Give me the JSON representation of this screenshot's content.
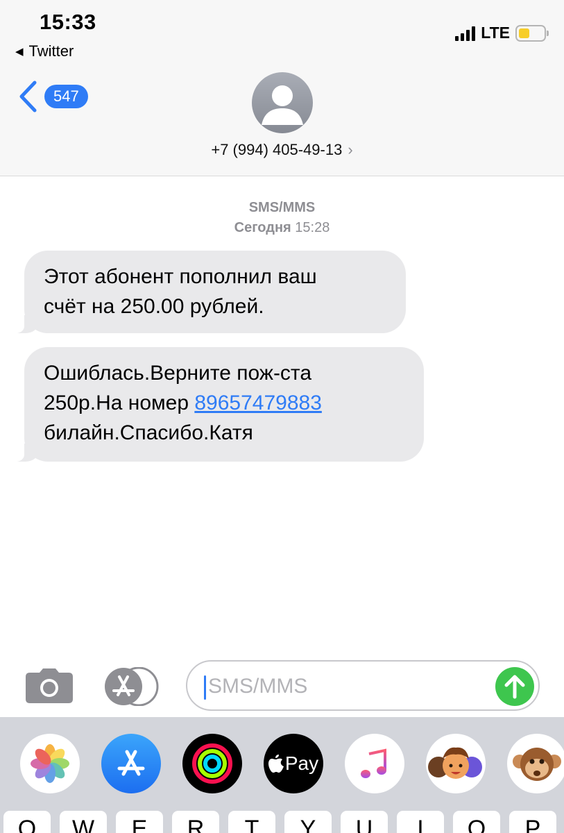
{
  "status_bar": {
    "time": "15:33",
    "back_app": "Twitter",
    "network": "LTE",
    "colors": {
      "battery_fill": "#f7ce2a"
    }
  },
  "header": {
    "unread_count": "547",
    "contact_number": "+7 (994) 405-49-13",
    "chevron": "›"
  },
  "thread": {
    "service_label": "SMS/MMS",
    "day_label": "Сегодня",
    "time_label": "15:28"
  },
  "messages": [
    {
      "line1": "Этот абонент пополнил ваш",
      "line2": "счёт на 250.00 рублей."
    },
    {
      "line1": "Ошиблась.Верните пож-ста",
      "line2_prefix": "250р.На номер ",
      "link": "89657479883",
      "line3": "билайн.Спасибо.Катя"
    }
  ],
  "compose": {
    "placeholder": "SMS/MMS",
    "value": ""
  },
  "app_drawer": {
    "apps": [
      "photos-icon",
      "app-store-icon",
      "fitness-icon",
      "apple-pay-icon",
      "music-icon",
      "memoji-icon",
      "animoji-monkey-icon"
    ],
    "pay_label": "Pay"
  },
  "keyboard": {
    "keys": [
      "Q",
      "W",
      "E",
      "R",
      "T",
      "Y",
      "U",
      "I",
      "O",
      "P"
    ]
  },
  "colors": {
    "accent": "#2f7cf6",
    "incoming_bubble": "#e9e9eb",
    "send": "#3ec64e"
  }
}
